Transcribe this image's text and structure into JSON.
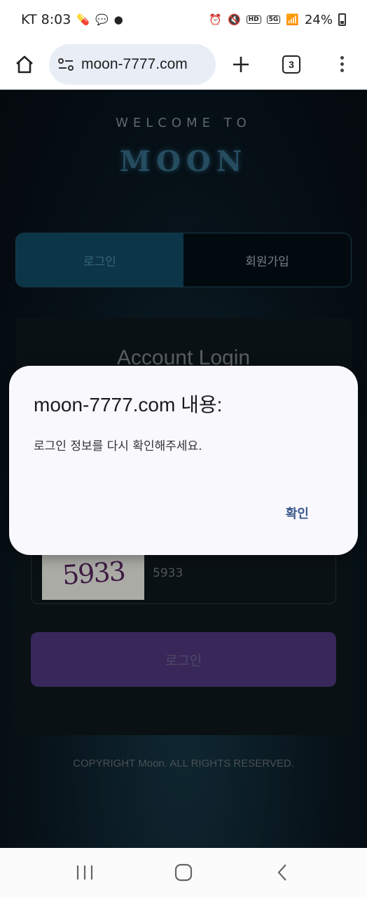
{
  "status_bar": {
    "carrier_time": "KT 8:03",
    "chip_hd": "HD",
    "chip_5g": "5G",
    "battery": "24%"
  },
  "browser": {
    "url": "moon-7777.com",
    "tab_count": "3"
  },
  "page": {
    "welcome": "WELCOME TO",
    "logo": "MOON",
    "tab_login": "로그인",
    "tab_signup": "회원가입",
    "card_title": "Account Login",
    "captcha_image_text": "5933",
    "captcha_value": "5933",
    "login_button": "로그인",
    "copyright": "COPYRIGHT Moon. ALL RIGHTS RESERVED."
  },
  "dialog": {
    "title": "moon-7777.com 내용:",
    "message": "로그인 정보를 다시 확인해주세요.",
    "ok_label": "확인"
  },
  "colors": {
    "accent_tab": "#0f3f55",
    "login_button": "#42306a",
    "dialog_ok": "#3c5a8a"
  }
}
